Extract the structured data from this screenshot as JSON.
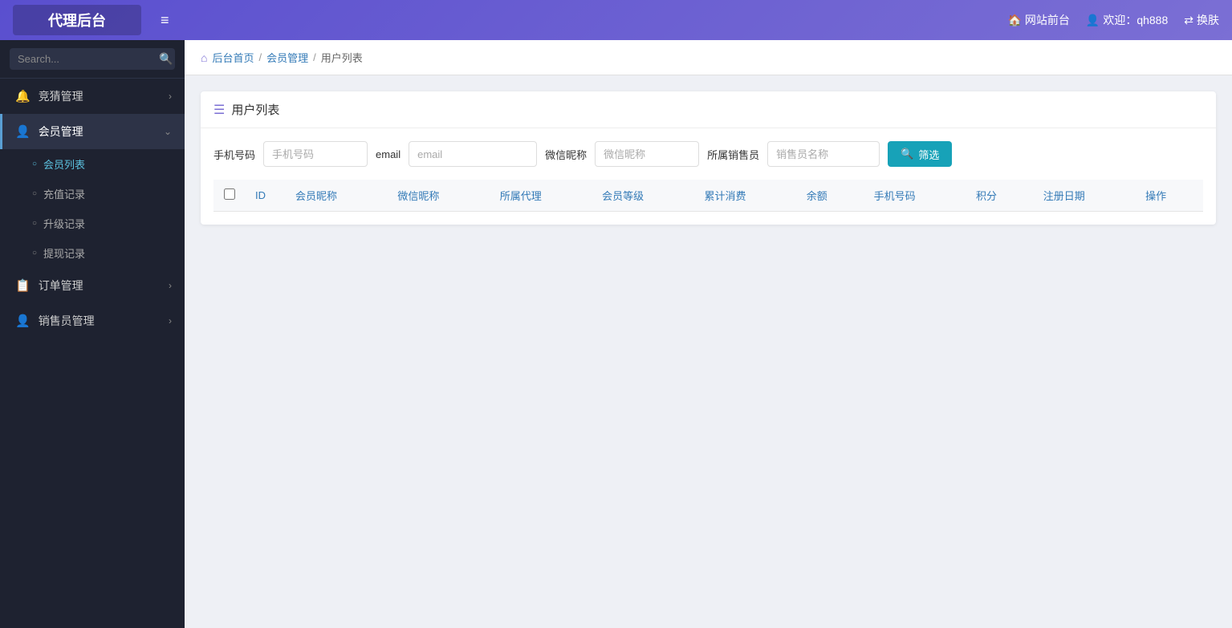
{
  "brand": {
    "title": "代理后台"
  },
  "header": {
    "menu_toggle": "≡",
    "website_front": "网站前台",
    "welcome": "欢迎：qh888",
    "switch_account": "换肤",
    "house_icon": "🏠",
    "user_icon": "👤",
    "swap_icon": "⇄"
  },
  "sidebar": {
    "search_placeholder": "Search...",
    "items": [
      {
        "id": "competition",
        "label": "竞猜管理",
        "icon": "🔔",
        "has_chevron": true,
        "expanded": false
      },
      {
        "id": "member",
        "label": "会员管理",
        "icon": "👤",
        "has_chevron": true,
        "expanded": true
      },
      {
        "id": "order",
        "label": "订单管理",
        "icon": "📋",
        "has_chevron": true,
        "expanded": false
      },
      {
        "id": "sales",
        "label": "销售员管理",
        "icon": "👤",
        "has_chevron": true,
        "expanded": false
      }
    ],
    "member_subitems": [
      {
        "id": "member-list",
        "label": "会员列表",
        "active": true
      },
      {
        "id": "recharge-records",
        "label": "充值记录",
        "active": false
      },
      {
        "id": "upgrade-records",
        "label": "升级记录",
        "active": false
      },
      {
        "id": "withdrawal-records",
        "label": "提现记录",
        "active": false
      }
    ]
  },
  "breadcrumb": {
    "home_label": "后台首页",
    "sep1": "/",
    "member_label": "会员管理",
    "sep2": "/",
    "current": "用户列表"
  },
  "page": {
    "card_title": "用户列表",
    "filter": {
      "phone_label": "手机号码",
      "phone_placeholder": "手机号码",
      "email_label": "email",
      "email_placeholder": "email",
      "wechat_label": "微信昵称",
      "wechat_placeholder": "微信昵称",
      "seller_label": "所属销售员",
      "seller_placeholder": "销售员名称",
      "filter_btn": "筛选",
      "search_icon": "🔍"
    },
    "table": {
      "columns": [
        {
          "id": "check",
          "label": ""
        },
        {
          "id": "id",
          "label": "ID"
        },
        {
          "id": "nickname",
          "label": "会员昵称"
        },
        {
          "id": "wechat",
          "label": "微信昵称"
        },
        {
          "id": "agent",
          "label": "所属代理"
        },
        {
          "id": "level",
          "label": "会员等级"
        },
        {
          "id": "cumulative",
          "label": "累计消费"
        },
        {
          "id": "balance",
          "label": "余额"
        },
        {
          "id": "phone",
          "label": "手机号码"
        },
        {
          "id": "points",
          "label": "积分"
        },
        {
          "id": "reg_date",
          "label": "注册日期"
        },
        {
          "id": "action",
          "label": "操作"
        }
      ],
      "rows": []
    }
  }
}
